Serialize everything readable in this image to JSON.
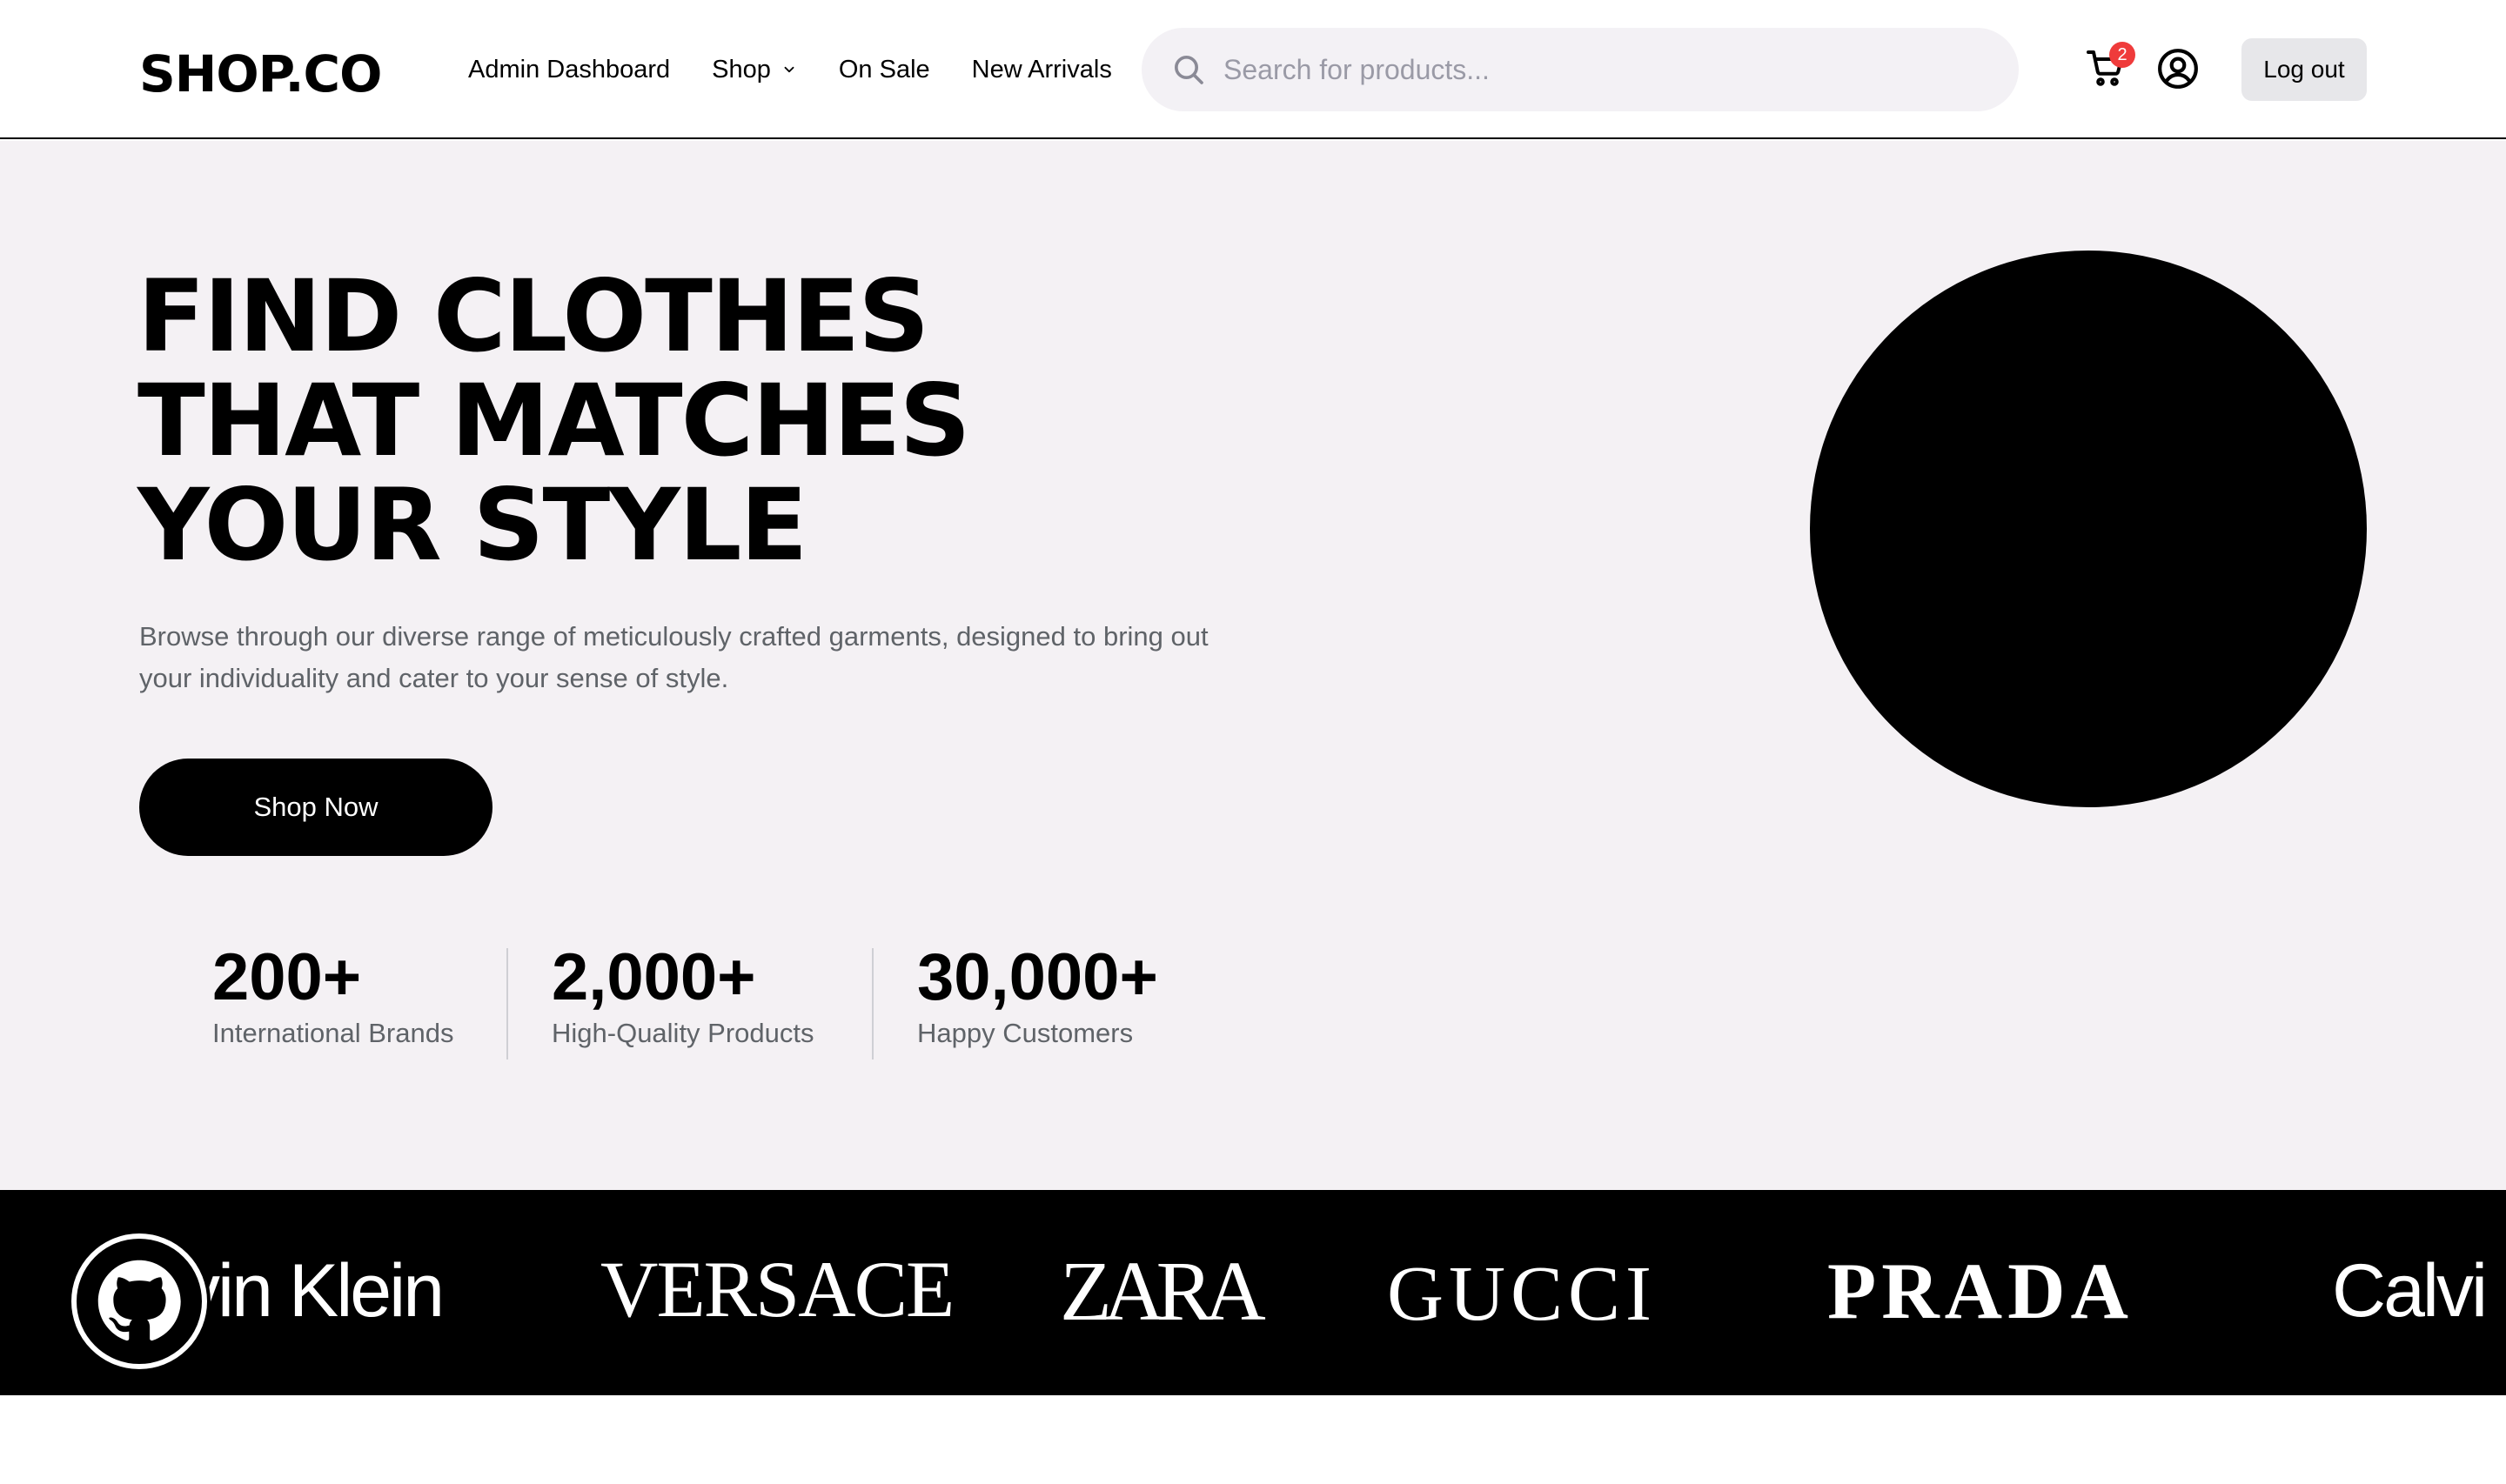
{
  "header": {
    "logo": "SHOP.CO",
    "nav": {
      "admin_dashboard": "Admin Dashboard",
      "shop": "Shop",
      "on_sale": "On Sale",
      "new_arrivals": "New Arrivals"
    },
    "search": {
      "placeholder": "Search for products...",
      "value": ""
    },
    "cart": {
      "icon": "cart-icon",
      "count": "2"
    },
    "account_icon": "user-circle-icon",
    "logout_label": "Log out"
  },
  "hero": {
    "title_lines": [
      "FIND CLOTHES",
      "THAT MATCHES",
      "YOUR STYLE"
    ],
    "subtitle": "Browse through our diverse range of meticulously crafted garments, designed to bring out your individuality and cater to your sense of style.",
    "cta_label": "Shop Now",
    "stats": [
      {
        "value": "200+",
        "label": "International Brands"
      },
      {
        "value": "2,000+",
        "label": "High-Quality Products"
      },
      {
        "value": "30,000+",
        "label": "Happy Customers"
      }
    ]
  },
  "brands": {
    "items": [
      "vin Klein",
      "VERSACE",
      "ZARA",
      "GUCCI",
      "PRADA",
      "Calvi"
    ]
  },
  "github_button": {
    "icon": "github-icon"
  },
  "colors": {
    "accent": "#000000",
    "hero_background": "#f4f1f4",
    "badge": "#ef3b3b",
    "muted_text": "#5f6368"
  }
}
